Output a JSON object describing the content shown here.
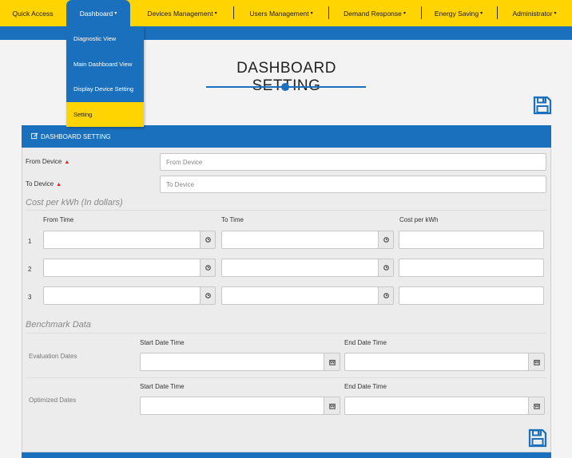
{
  "nav": {
    "items": [
      {
        "label": "Quick Access",
        "caret": ""
      },
      {
        "label": "Dashboard",
        "caret": "▾"
      },
      {
        "label": "Devices Management",
        "caret": "▾"
      },
      {
        "label": "Users Management",
        "caret": "▾"
      },
      {
        "label": "Demand Response",
        "caret": "▾"
      },
      {
        "label": "Energy Saving",
        "caret": "▾"
      },
      {
        "label": "Administrator",
        "caret": "▾"
      }
    ]
  },
  "dropdown": {
    "items": [
      {
        "label": "Diagnostic View"
      },
      {
        "label": "Main Dashboard View"
      },
      {
        "label": "Display Device Setting"
      },
      {
        "label": "Setting"
      }
    ]
  },
  "page": {
    "title": "DASHBOARD SETTING"
  },
  "panel": {
    "header": "DASHBOARD SETTING",
    "from_device_label": "From Device",
    "from_device_placeholder": "From Device",
    "to_device_label": "To Device",
    "to_device_placeholder": "To Device",
    "required_mark": "▲",
    "cost_section": "Cost per kWh (In dollars)",
    "cost_headers": [
      "From Time",
      "To Time",
      "Cost per kWh"
    ],
    "cost_rows": [
      "1",
      "2",
      "3"
    ],
    "benchmark_section": "Benchmark Data",
    "evaluation_label": "Evaluation Dates",
    "optimized_label": "Optimized Dates",
    "start_label": "Start Date Time",
    "end_label": "End Date Time"
  },
  "colors": {
    "accent_yellow": "#ffd400",
    "primary_blue": "#1b70bd"
  }
}
